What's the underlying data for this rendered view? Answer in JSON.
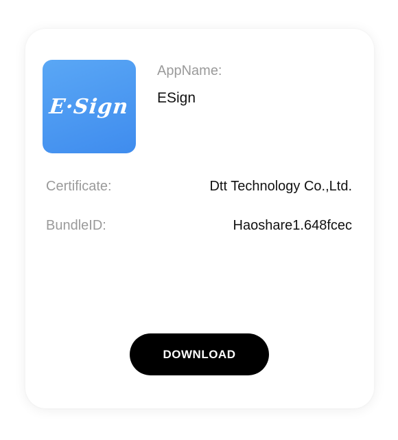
{
  "app": {
    "icon_text": "E·Sign",
    "icon_name": "esign-app-icon",
    "name_label": "AppName:",
    "name_value": "ESign"
  },
  "details": {
    "certificate_label": "Certificate:",
    "certificate_value": "Dtt Technology Co.,Ltd.",
    "bundle_label": "BundleID:",
    "bundle_value": "Haoshare1.648fcec"
  },
  "actions": {
    "download_label": "DOWNLOAD"
  },
  "colors": {
    "icon_gradient_start": "#5aa7f5",
    "icon_gradient_end": "#3f8cee",
    "button_background": "#000000",
    "label_gray": "#9a9a9a"
  }
}
